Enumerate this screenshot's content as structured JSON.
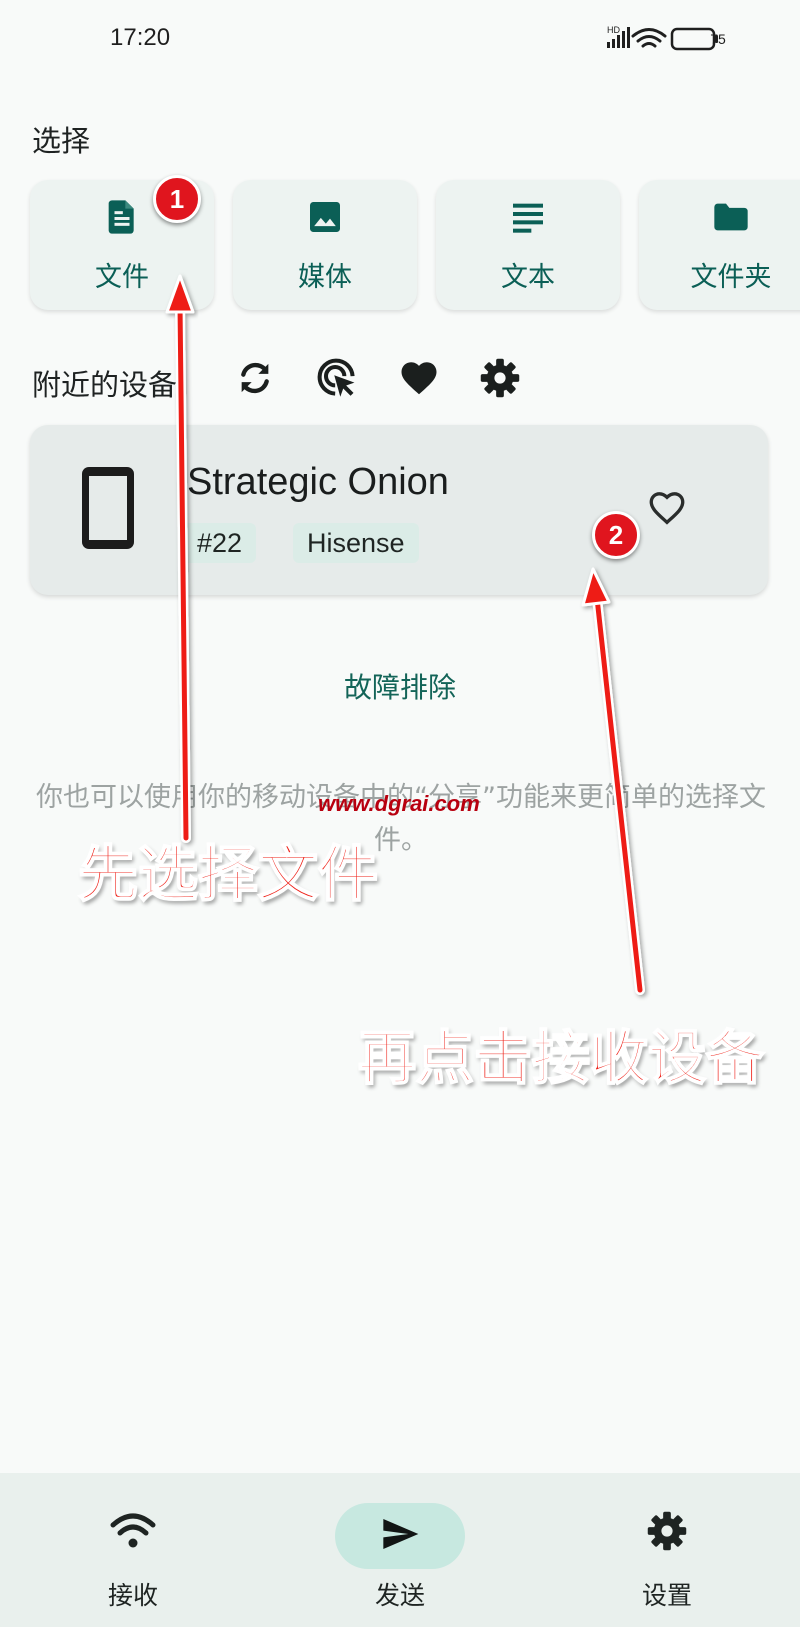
{
  "status_bar": {
    "time": "17:20",
    "battery": "75",
    "icons": [
      "hd-signal-icon",
      "wifi-icon",
      "battery-icon"
    ]
  },
  "select_section": {
    "title": "选择",
    "options": [
      {
        "label": "文件",
        "icon": "document-icon"
      },
      {
        "label": "媒体",
        "icon": "image-icon"
      },
      {
        "label": "文本",
        "icon": "text-lines-icon"
      },
      {
        "label": "文件夹",
        "icon": "folder-icon"
      }
    ]
  },
  "nearby_section": {
    "title": "附近的设备",
    "actions": [
      "refresh-icon",
      "cursor-target-icon",
      "heart-icon",
      "gear-icon"
    ]
  },
  "device": {
    "name": "Strategic Onion",
    "tags": [
      "#22",
      "Hisense"
    ],
    "icon": "phone-icon",
    "favorite_icon": "heart-outline-icon"
  },
  "troubleshoot_link": "故障排除",
  "hint": "你也可以使用你的移动设备中的“分享”功能来更简单的选择文件。",
  "bottom_nav": [
    {
      "label": "接收",
      "icon": "wifi-icon",
      "active": false
    },
    {
      "label": "发送",
      "icon": "send-icon",
      "active": true
    },
    {
      "label": "设置",
      "icon": "gear-icon",
      "active": false
    }
  ],
  "annotations": {
    "step1_badge": "1",
    "step2_badge": "2",
    "step1_text": "先选择文件",
    "step2_text": "再点击接收设备",
    "watermark": "www.dgrai.com"
  },
  "colors": {
    "accent": "#0b5f56",
    "card_bg": "#edf3f1",
    "annotation_red": "#ee1f16"
  }
}
